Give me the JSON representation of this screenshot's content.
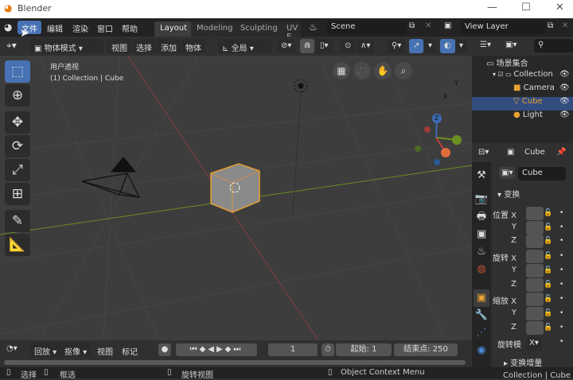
{
  "app": {
    "title": "Blender",
    "window_controls": {
      "minimize": "—",
      "maximize": "☐",
      "close": "✕"
    }
  },
  "menu": [
    "文件",
    "编辑",
    "渲染",
    "窗口",
    "帮助"
  ],
  "workspaces": [
    "Layout",
    "Modeling",
    "Sculpting",
    "UV E"
  ],
  "scene": "Scene",
  "view_layer": "View Layer",
  "header": {
    "mode": "物体模式",
    "items": [
      "视图",
      "选择",
      "添加",
      "物体"
    ],
    "transform_orientation": "全局"
  },
  "viewport": {
    "view_name": "用户透视",
    "context": "(1) Collection | Cube",
    "gizmo": {
      "x": "X",
      "y": "Y",
      "z": "Z"
    }
  },
  "outliner": {
    "root": "场景集合",
    "items": [
      "Collection",
      "Camera",
      "Cube",
      "Light"
    ]
  },
  "properties": {
    "object_name": "Cube",
    "datablock_name": "Cube",
    "section": "变换",
    "rows": [
      {
        "label": "位置 X"
      },
      {
        "label": "Y"
      },
      {
        "label": "Z"
      },
      {
        "label": "旋转 X"
      },
      {
        "label": "Y"
      },
      {
        "label": "Z"
      },
      {
        "label": "缩放 X"
      },
      {
        "label": "Y"
      },
      {
        "label": "Z"
      }
    ],
    "rotation_mode_label": "旋转模",
    "rotation_mode_value": "X",
    "delta_section": "变换增量"
  },
  "timeline": {
    "playback": "回放",
    "keying": "抠像",
    "view": "视图",
    "marker": "标记",
    "current_frame": "1",
    "start_label": "起始:",
    "start": "1",
    "end_label": "结束点:",
    "end": "250"
  },
  "status": {
    "select": "选择",
    "box_select": "框选",
    "rotate_view": "旋转视图",
    "context_menu": "Object Context Menu",
    "info": "Collection | Cube | 点"
  },
  "colors": {
    "accent": "#4772b3",
    "selected": "#e8a033",
    "x_axis": "#a03b3b",
    "y_axis": "#6b8e23"
  }
}
